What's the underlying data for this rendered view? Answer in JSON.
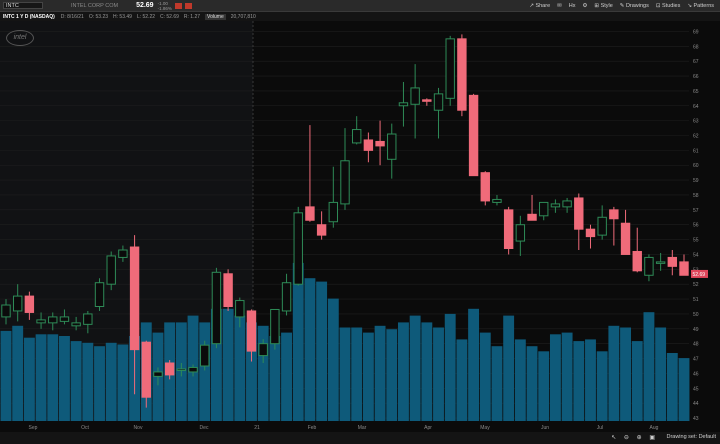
{
  "topbar": {
    "symbol": "INTC",
    "company": "INTEL CORP COM",
    "price": "52.69",
    "change": "-1.00",
    "change_pct": "-1.86%",
    "buttons": [
      "Share",
      "Hx",
      "Style",
      "Drawings",
      "Studies",
      "Patterns"
    ]
  },
  "infobar": {
    "title": "INTC 1 Y D (NASDAQ)",
    "date": "D: 8/16/21",
    "open": "O: 53.23",
    "high": "H: 53.49",
    "low": "L: 52.22",
    "close": "C: 52.69",
    "rng": "R: 1.27",
    "volume_label": "Volume",
    "volume": "20,707,810"
  },
  "logo": "intel",
  "chart_data": {
    "type": "candlestick",
    "x_labels": [
      "Sep",
      "Oct",
      "Nov",
      "Dec",
      "21",
      "Feb",
      "Mar",
      "Apr",
      "May",
      "Jun",
      "Jul",
      "Aug"
    ],
    "y_ticks": [
      44,
      45,
      46,
      47,
      48,
      49,
      50,
      51,
      52,
      53,
      54,
      55,
      56,
      57,
      58,
      59,
      60,
      61,
      62,
      63,
      64,
      65,
      66,
      67,
      68,
      69
    ],
    "y_ticks_shown": [
      43,
      44,
      45,
      46,
      47,
      48,
      49,
      50,
      51,
      52,
      53,
      54,
      55,
      56,
      57,
      58,
      59,
      60,
      61,
      62,
      63,
      64,
      65,
      66,
      67,
      68,
      69
    ],
    "ylim": [
      42.8,
      69.7
    ],
    "last_price_label": "52.69",
    "up_color": "#2e8b57",
    "down_color": "#f06b7a",
    "volume_color": "#0e5a7a",
    "candles": [
      {
        "o": 49.8,
        "h": 51.0,
        "l": 49.3,
        "c": 50.6
      },
      {
        "o": 50.2,
        "h": 52.0,
        "l": 49.5,
        "c": 51.2
      },
      {
        "o": 51.2,
        "h": 51.5,
        "l": 49.6,
        "c": 50.1
      },
      {
        "o": 49.4,
        "h": 50.1,
        "l": 49.0,
        "c": 49.6
      },
      {
        "o": 49.4,
        "h": 50.1,
        "l": 48.9,
        "c": 49.8
      },
      {
        "o": 49.5,
        "h": 50.3,
        "l": 49.3,
        "c": 49.8
      },
      {
        "o": 49.2,
        "h": 49.8,
        "l": 48.9,
        "c": 49.4
      },
      {
        "o": 49.3,
        "h": 50.2,
        "l": 48.7,
        "c": 50.0
      },
      {
        "o": 50.5,
        "h": 52.4,
        "l": 50.2,
        "c": 52.1
      },
      {
        "o": 52.0,
        "h": 54.2,
        "l": 51.6,
        "c": 53.9
      },
      {
        "o": 53.8,
        "h": 54.6,
        "l": 53.5,
        "c": 54.3
      },
      {
        "o": 54.5,
        "h": 55.3,
        "l": 44.6,
        "c": 47.6
      },
      {
        "o": 48.1,
        "h": 48.2,
        "l": 43.7,
        "c": 44.4
      },
      {
        "o": 45.8,
        "h": 46.4,
        "l": 45.2,
        "c": 46.1
      },
      {
        "o": 46.7,
        "h": 46.9,
        "l": 45.6,
        "c": 45.9
      },
      {
        "o": 46.2,
        "h": 46.7,
        "l": 45.8,
        "c": 46.3
      },
      {
        "o": 46.1,
        "h": 46.6,
        "l": 45.8,
        "c": 46.4
      },
      {
        "o": 46.5,
        "h": 48.2,
        "l": 46.2,
        "c": 47.9
      },
      {
        "o": 48.0,
        "h": 53.1,
        "l": 47.7,
        "c": 52.8
      },
      {
        "o": 52.7,
        "h": 53.0,
        "l": 50.2,
        "c": 50.5
      },
      {
        "o": 49.8,
        "h": 51.1,
        "l": 49.1,
        "c": 50.9
      },
      {
        "o": 50.2,
        "h": 50.3,
        "l": 46.8,
        "c": 47.5
      },
      {
        "o": 47.2,
        "h": 48.3,
        "l": 46.7,
        "c": 48.0
      },
      {
        "o": 48.0,
        "h": 50.0,
        "l": 47.6,
        "c": 50.3
      },
      {
        "o": 50.2,
        "h": 52.7,
        "l": 49.9,
        "c": 52.1
      },
      {
        "o": 52.0,
        "h": 57.2,
        "l": 51.9,
        "c": 56.8
      },
      {
        "o": 57.2,
        "h": 62.7,
        "l": 56.2,
        "c": 56.3
      },
      {
        "o": 56.0,
        "h": 56.9,
        "l": 55.0,
        "c": 55.3
      },
      {
        "o": 56.2,
        "h": 59.9,
        "l": 55.8,
        "c": 57.5
      },
      {
        "o": 57.4,
        "h": 62.5,
        "l": 57.0,
        "c": 60.3
      },
      {
        "o": 61.5,
        "h": 63.3,
        "l": 61.4,
        "c": 62.4
      },
      {
        "o": 61.7,
        "h": 62.2,
        "l": 60.2,
        "c": 61.0
      },
      {
        "o": 61.6,
        "h": 63.0,
        "l": 60.0,
        "c": 61.3
      },
      {
        "o": 60.4,
        "h": 62.8,
        "l": 59.1,
        "c": 62.1
      },
      {
        "o": 64.0,
        "h": 65.6,
        "l": 62.6,
        "c": 64.2
      },
      {
        "o": 64.1,
        "h": 66.8,
        "l": 61.8,
        "c": 65.2
      },
      {
        "o": 64.4,
        "h": 64.5,
        "l": 64.0,
        "c": 64.3
      },
      {
        "o": 63.7,
        "h": 65.2,
        "l": 61.8,
        "c": 64.8
      },
      {
        "o": 64.5,
        "h": 68.7,
        "l": 64.0,
        "c": 68.5
      },
      {
        "o": 68.5,
        "h": 68.8,
        "l": 63.3,
        "c": 63.7
      },
      {
        "o": 64.7,
        "h": 64.8,
        "l": 59.5,
        "c": 59.3
      },
      {
        "o": 59.5,
        "h": 59.6,
        "l": 57.3,
        "c": 57.6
      },
      {
        "o": 57.5,
        "h": 58.0,
        "l": 57.3,
        "c": 57.7
      },
      {
        "o": 57.0,
        "h": 57.2,
        "l": 54.0,
        "c": 54.4
      },
      {
        "o": 54.9,
        "h": 56.6,
        "l": 53.9,
        "c": 56.0
      },
      {
        "o": 56.7,
        "h": 58.0,
        "l": 56.4,
        "c": 56.3
      },
      {
        "o": 56.6,
        "h": 57.5,
        "l": 56.3,
        "c": 57.5
      },
      {
        "o": 57.2,
        "h": 57.7,
        "l": 56.8,
        "c": 57.4
      },
      {
        "o": 57.2,
        "h": 57.8,
        "l": 56.8,
        "c": 57.6
      },
      {
        "o": 57.8,
        "h": 58.1,
        "l": 54.3,
        "c": 55.7
      },
      {
        "o": 55.7,
        "h": 56.0,
        "l": 54.4,
        "c": 55.2
      },
      {
        "o": 55.3,
        "h": 57.3,
        "l": 55.0,
        "c": 56.5
      },
      {
        "o": 57.0,
        "h": 57.2,
        "l": 54.6,
        "c": 56.4
      },
      {
        "o": 56.1,
        "h": 57.0,
        "l": 54.0,
        "c": 54.0
      },
      {
        "o": 54.2,
        "h": 55.8,
        "l": 52.8,
        "c": 52.9
      },
      {
        "o": 52.6,
        "h": 54.0,
        "l": 52.2,
        "c": 53.8
      },
      {
        "o": 53.4,
        "h": 54.1,
        "l": 52.9,
        "c": 53.5
      },
      {
        "o": 53.8,
        "h": 54.3,
        "l": 52.6,
        "c": 53.2
      },
      {
        "o": 53.5,
        "h": 54.0,
        "l": 52.7,
        "c": 52.6
      }
    ],
    "volume": [
      53,
      56,
      49,
      51,
      51,
      50,
      47,
      46,
      44,
      46,
      45,
      50,
      58,
      52,
      58,
      58,
      62,
      58,
      66,
      66,
      62,
      58,
      56,
      50,
      52,
      93,
      84,
      82,
      72,
      55,
      55,
      52,
      56,
      54,
      58,
      62,
      58,
      55,
      63,
      48,
      66,
      52,
      44,
      62,
      48,
      44,
      41,
      51,
      52,
      47,
      48,
      41,
      56,
      55,
      47,
      64,
      55,
      40,
      37
    ]
  }
}
